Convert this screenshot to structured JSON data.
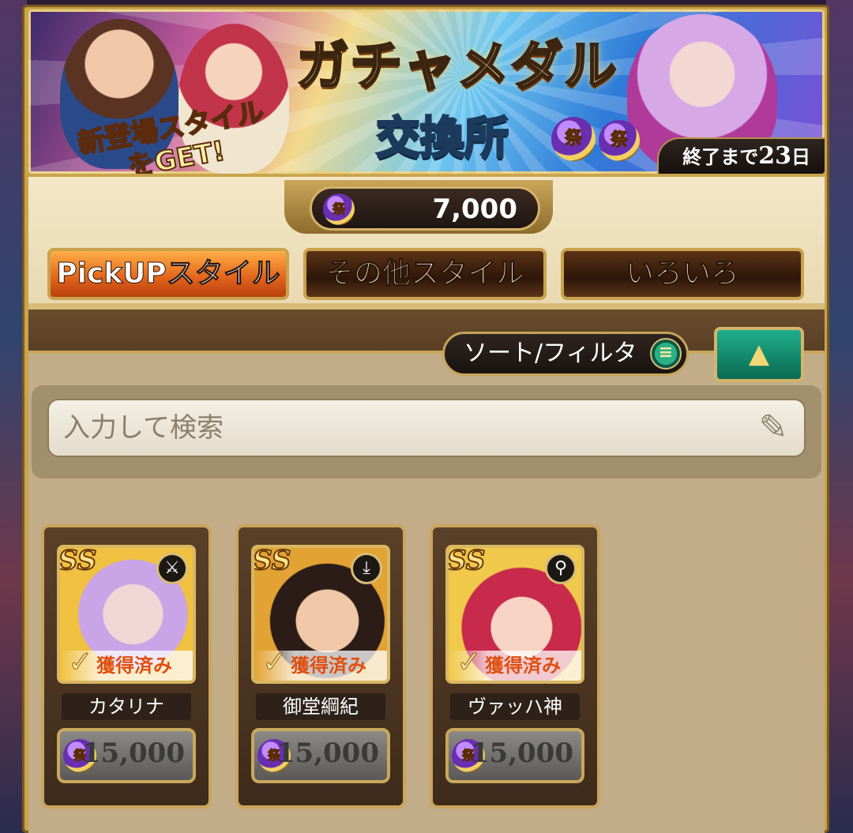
{
  "banner": {
    "title": "ガチャメダル",
    "subtitle": "交換所",
    "badge": "新登場スタイルをGET!",
    "medal_glyph": "祭",
    "ends_prefix": "終了まで",
    "ends_days": "23",
    "ends_unit": "日"
  },
  "currency": {
    "icon": "gacha-medal-icon",
    "value": "7,000"
  },
  "tabs": [
    {
      "label": "PickUPスタイル",
      "active": true
    },
    {
      "label": "その他スタイル",
      "active": false
    },
    {
      "label": "いろいろ",
      "active": false
    }
  ],
  "toolbar": {
    "sort_label": "ソート/フィルタ",
    "sort_icon": "list-icon",
    "collapse_icon": "triangle-up-icon"
  },
  "search": {
    "placeholder": "入力して検索",
    "icon": "edit-icon"
  },
  "cards": [
    {
      "rank": "SS",
      "weapon_icon": "sword-icon",
      "owned_label": "獲得済み",
      "name": "カタリナ",
      "price": "15,000"
    },
    {
      "rank": "SS",
      "weapon_icon": "spear-icon",
      "owned_label": "獲得済み",
      "name": "御堂綱紀",
      "price": "15,000"
    },
    {
      "rank": "SS",
      "weapon_icon": "staff-icon",
      "owned_label": "獲得済み",
      "name": "ヴァッハ神",
      "price": "15,000"
    }
  ],
  "colors": {
    "gold_frame": "#c9a44c",
    "active_tab": "#e0621b",
    "inactive_tab": "#2e160a",
    "owned_text": "#e04f10",
    "collapse_button": "#1fae8a"
  }
}
